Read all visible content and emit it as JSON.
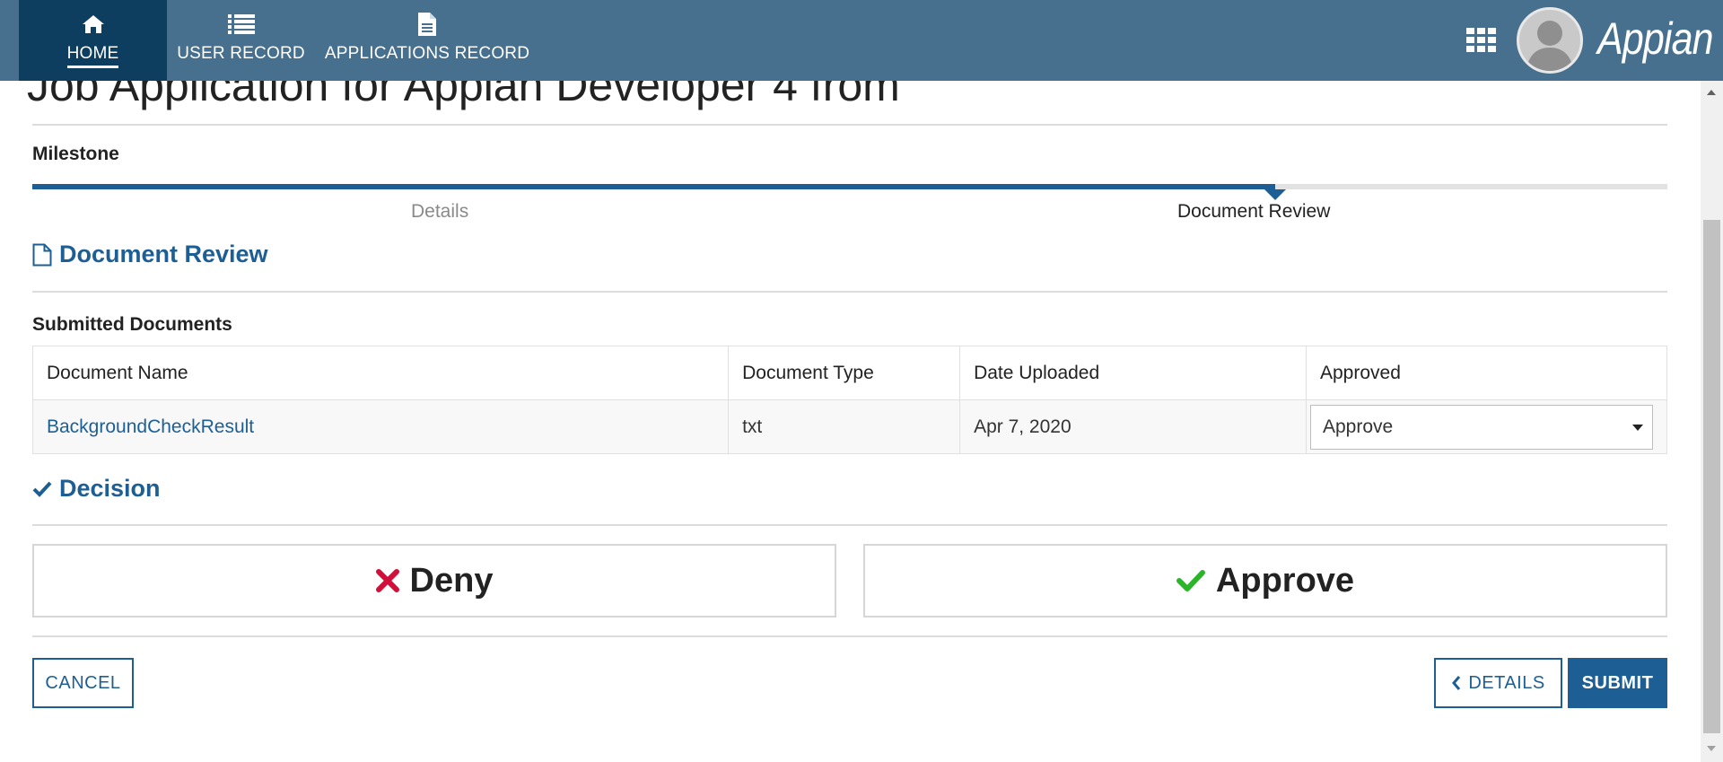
{
  "nav": {
    "tabs": [
      {
        "label": "HOME",
        "icon": "home-icon",
        "active": true
      },
      {
        "label": "USER RECORD",
        "icon": "list-icon",
        "active": false
      },
      {
        "label": "APPLICATIONS RECORD",
        "icon": "document-icon",
        "active": false
      }
    ],
    "brand": "Appian",
    "apps_icon": "apps-grid-icon",
    "avatar_icon": "user-avatar-icon"
  },
  "page": {
    "title": "Job Application for Appian Developer 4 from"
  },
  "milestone": {
    "label": "Milestone",
    "steps": [
      {
        "label": "Details",
        "state": "done"
      },
      {
        "label": "Document Review",
        "state": "current"
      }
    ],
    "progress_fraction": 0.76
  },
  "document_review": {
    "title": "Document Review",
    "icon": "file-icon",
    "submitted_label": "Submitted Documents",
    "columns": [
      "Document Name",
      "Document Type",
      "Date Uploaded",
      "Approved"
    ],
    "rows": [
      {
        "name": "BackgroundCheckResult",
        "type": "txt",
        "date": "Apr 7, 2020",
        "approved": "Approve"
      }
    ]
  },
  "decision": {
    "title": "Decision",
    "icon": "check-icon",
    "deny_label": "Deny",
    "approve_label": "Approve"
  },
  "buttons": {
    "cancel": "CANCEL",
    "details": "DETAILS",
    "submit": "SUBMIT"
  },
  "colors": {
    "header": "#47708f",
    "header_active": "#0d3d5f",
    "accent": "#1d5f94",
    "deny": "#d0103a",
    "approve": "#2bb52b"
  }
}
